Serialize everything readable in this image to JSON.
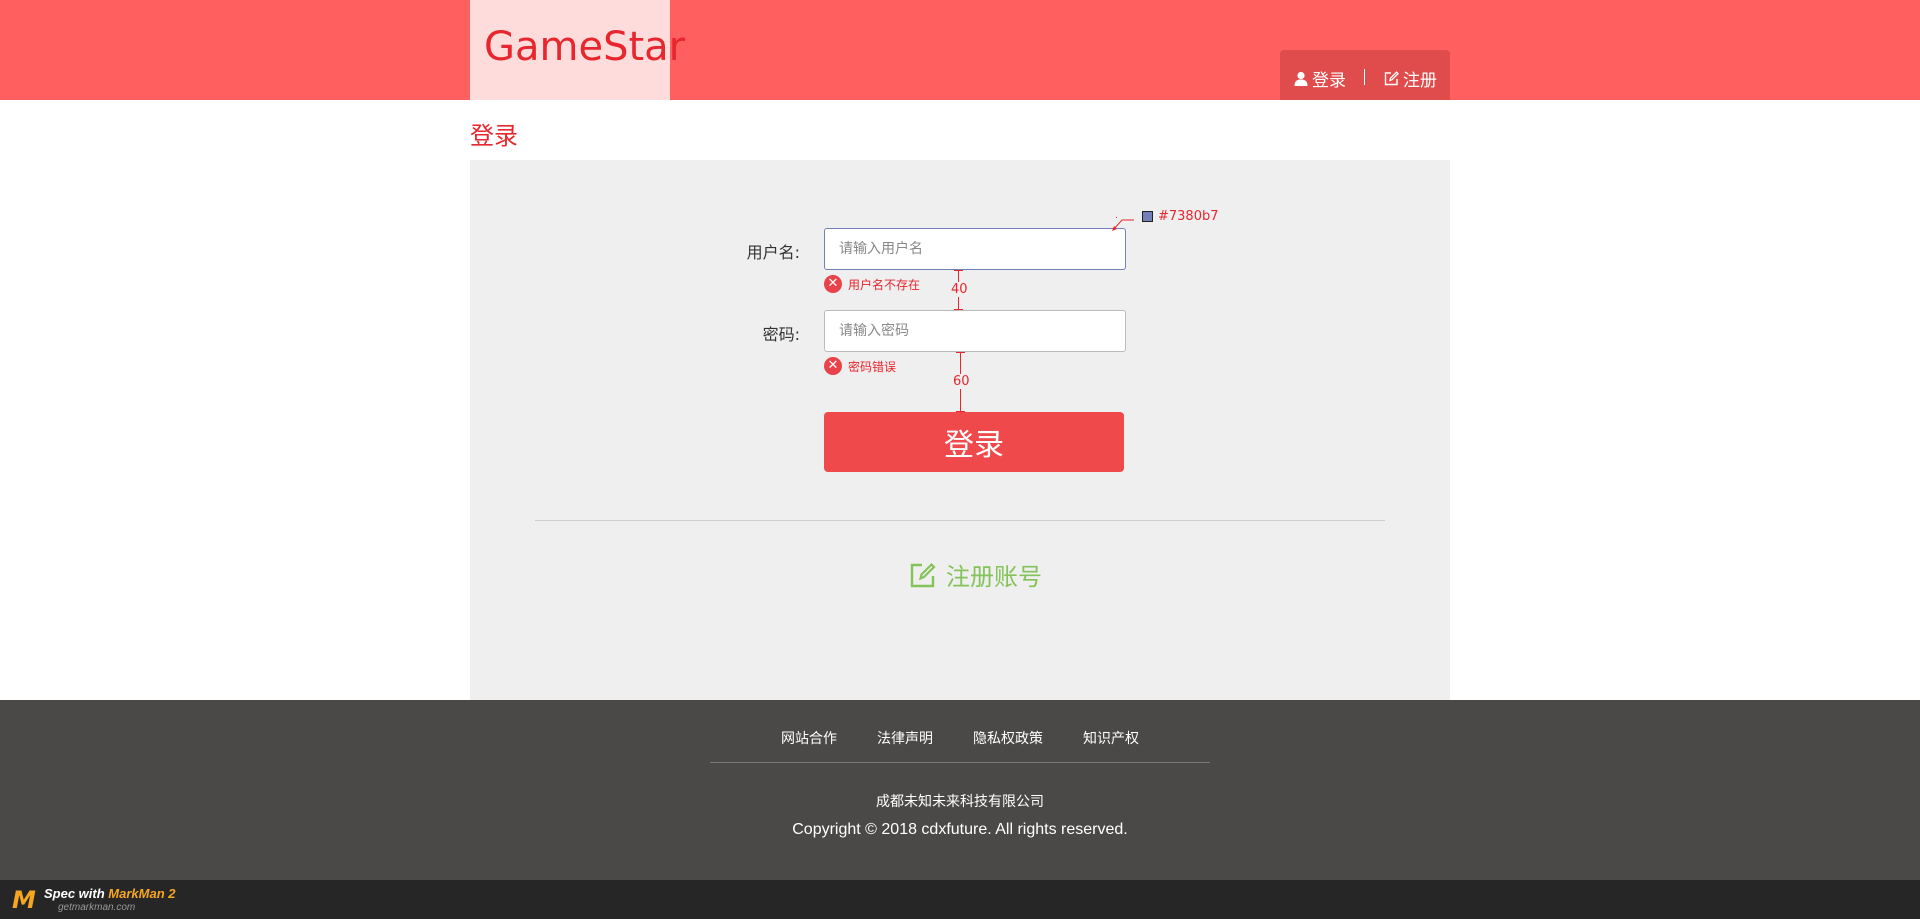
{
  "header": {
    "logo": "GameStar",
    "login_link": "登录",
    "register_link": "注册"
  },
  "page": {
    "title": "登录"
  },
  "form": {
    "username_label": "用户名:",
    "username_placeholder": "请输入用户名",
    "username_error": "用户名不存在",
    "password_label": "密码:",
    "password_placeholder": "请输入密码",
    "password_error": "密码错误",
    "submit_label": "登录",
    "register_label": "注册账号"
  },
  "spec": {
    "color_value": "#7380b7",
    "gap_1": "40",
    "gap_2": "60"
  },
  "footer": {
    "links": [
      "网站合作",
      "法律声明",
      "隐私权政策",
      "知识产权"
    ],
    "company": "成都未知未来科技有限公司",
    "copyright": "Copyright © 2018 cdxfuture. All rights reserved."
  },
  "watermark": {
    "line1_prefix": "Spec with ",
    "line1_brand": "MarkMan 2",
    "line2": "getmarkman.com"
  },
  "colors": {
    "header_bg": "#ff5f5f",
    "accent_red": "#e7262d",
    "register_green": "#84c359",
    "input_focus": "#7380b7"
  }
}
